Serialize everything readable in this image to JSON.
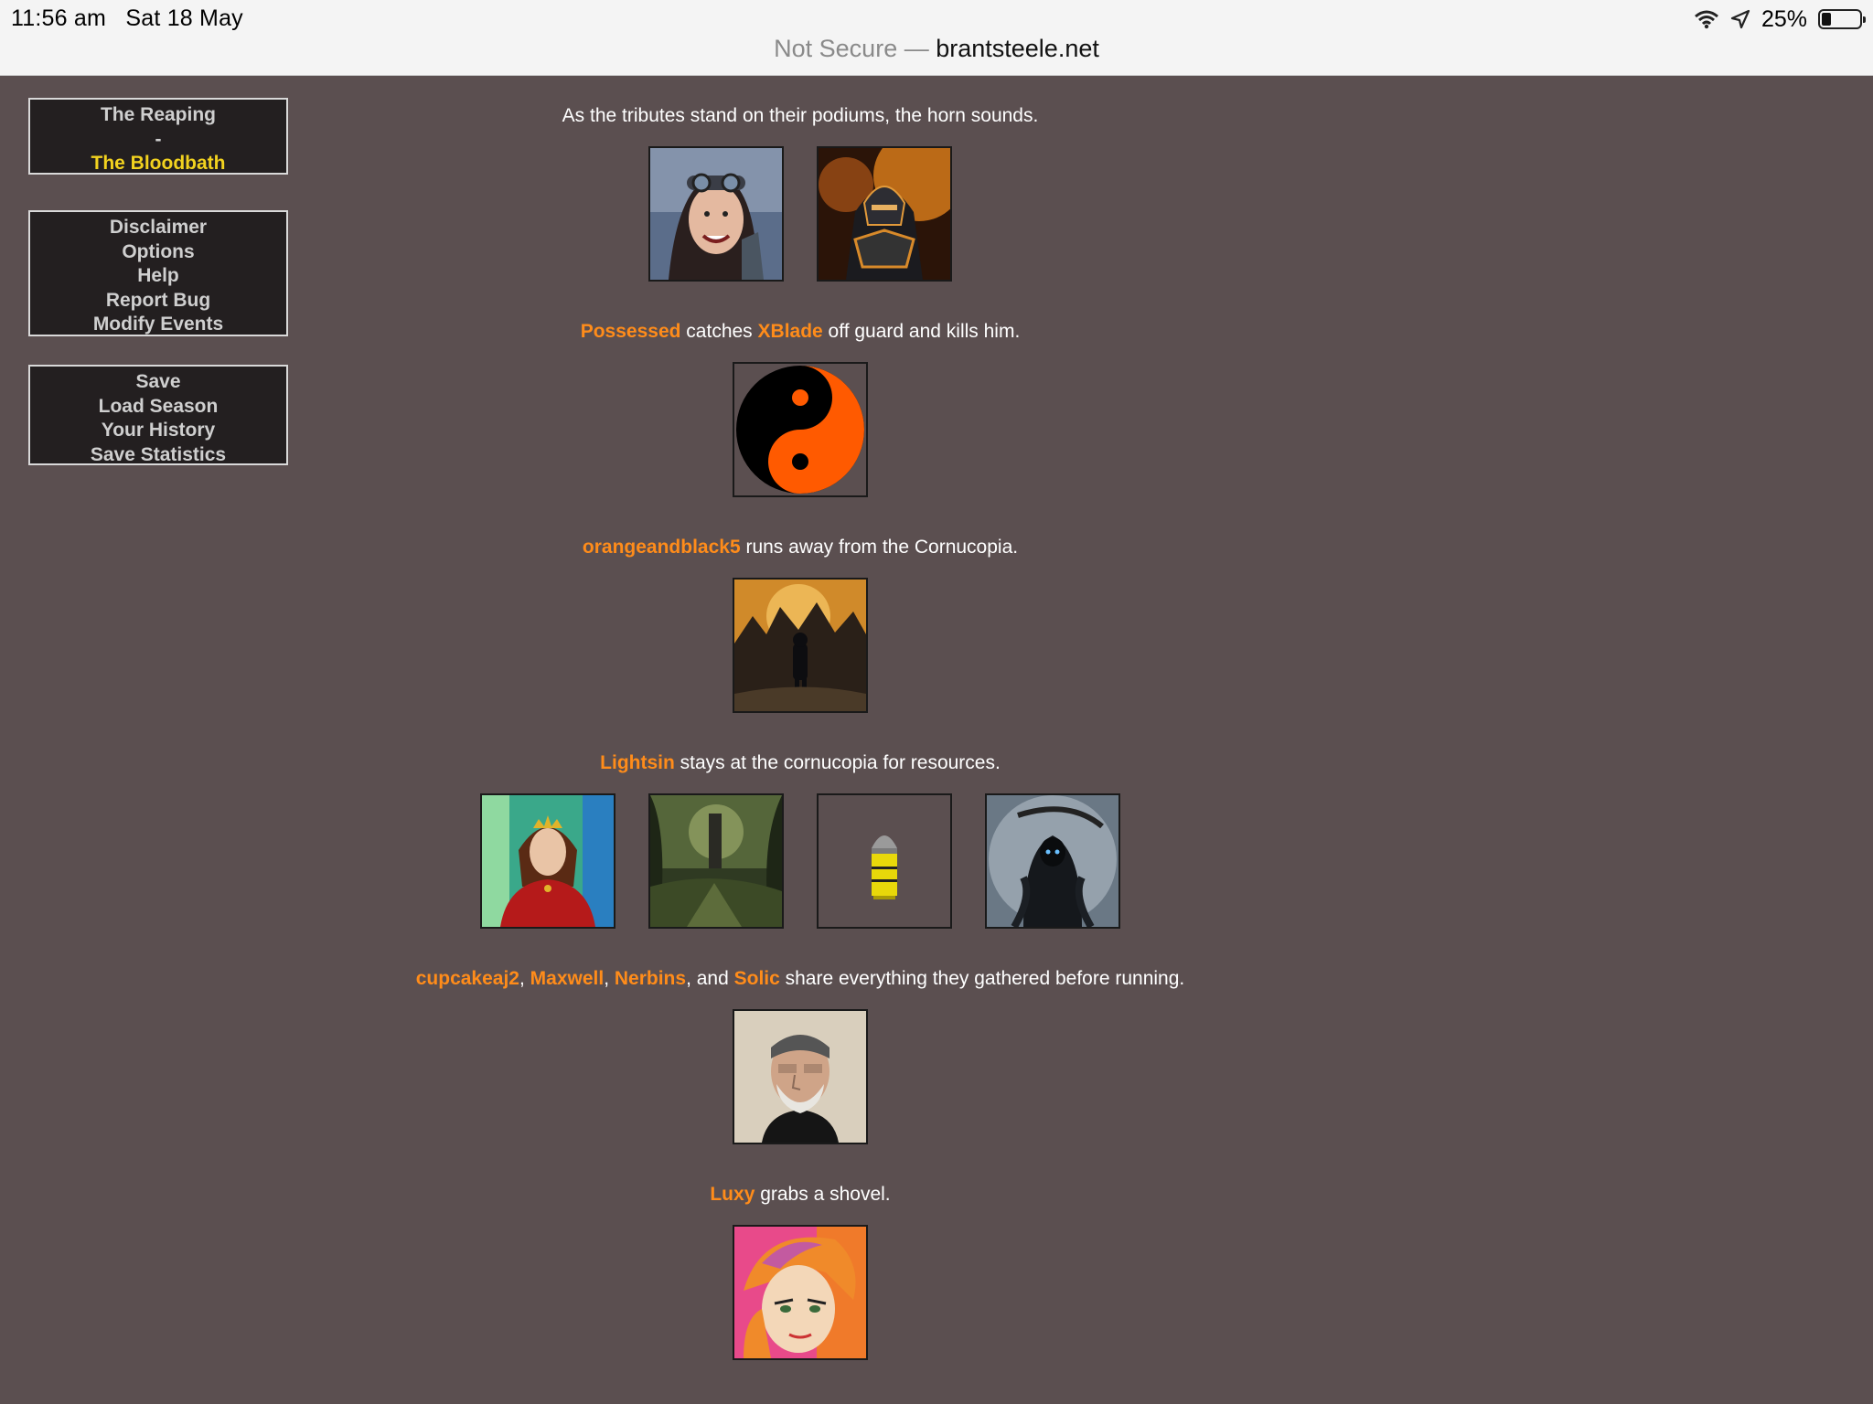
{
  "status_bar": {
    "time": "11:56 am",
    "date": "Sat 18 May",
    "battery": "25%",
    "battery_level": 0.25
  },
  "address_bar": {
    "prefix": "Not Secure —",
    "domain": "brantsteele.net"
  },
  "nav_phases": {
    "reaping": "The Reaping",
    "separator": "-",
    "bloodbath": "The Bloodbath"
  },
  "nav_info": [
    "Disclaimer",
    "Options",
    "Help",
    "Report Bug",
    "Modify Events"
  ],
  "nav_save": [
    "Save",
    "Load Season",
    "Your History",
    "Save Statistics"
  ],
  "intro": "As the tributes stand on their podiums, the horn sounds.",
  "events": [
    {
      "portraits": [
        "goggles-woman",
        "dark-knight"
      ],
      "parts": [
        {
          "t": "Possessed",
          "name": true
        },
        {
          "t": " catches ",
          "name": false
        },
        {
          "t": "XBlade",
          "name": true
        },
        {
          "t": " off guard and kills him.",
          "name": false
        }
      ]
    },
    {
      "portraits": [
        "yin-yang"
      ],
      "parts": [
        {
          "t": "orangeandblack5",
          "name": true
        },
        {
          "t": " runs away from the Cornucopia.",
          "name": false
        }
      ]
    },
    {
      "portraits": [
        "soldier-explosion"
      ],
      "parts": [
        {
          "t": "Lightsin",
          "name": true
        },
        {
          "t": " stays at the cornucopia for resources.",
          "name": false
        }
      ]
    },
    {
      "portraits": [
        "queen-red-dress",
        "forest-ruins",
        "yellow-bullet",
        "reaper"
      ],
      "parts": [
        {
          "t": "cupcakeaj2",
          "name": true
        },
        {
          "t": ", ",
          "name": false
        },
        {
          "t": "Maxwell",
          "name": true
        },
        {
          "t": ", ",
          "name": false
        },
        {
          "t": "Nerbins",
          "name": true
        },
        {
          "t": ", and ",
          "name": false
        },
        {
          "t": "Solic",
          "name": true
        },
        {
          "t": " share everything they gathered before running.",
          "name": false
        }
      ]
    },
    {
      "portraits": [
        "bearded-man"
      ],
      "parts": [
        {
          "t": "Luxy",
          "name": true
        },
        {
          "t": " grabs a shovel.",
          "name": false
        }
      ]
    },
    {
      "portraits": [
        "anime-orange-hair"
      ],
      "parts": []
    }
  ]
}
